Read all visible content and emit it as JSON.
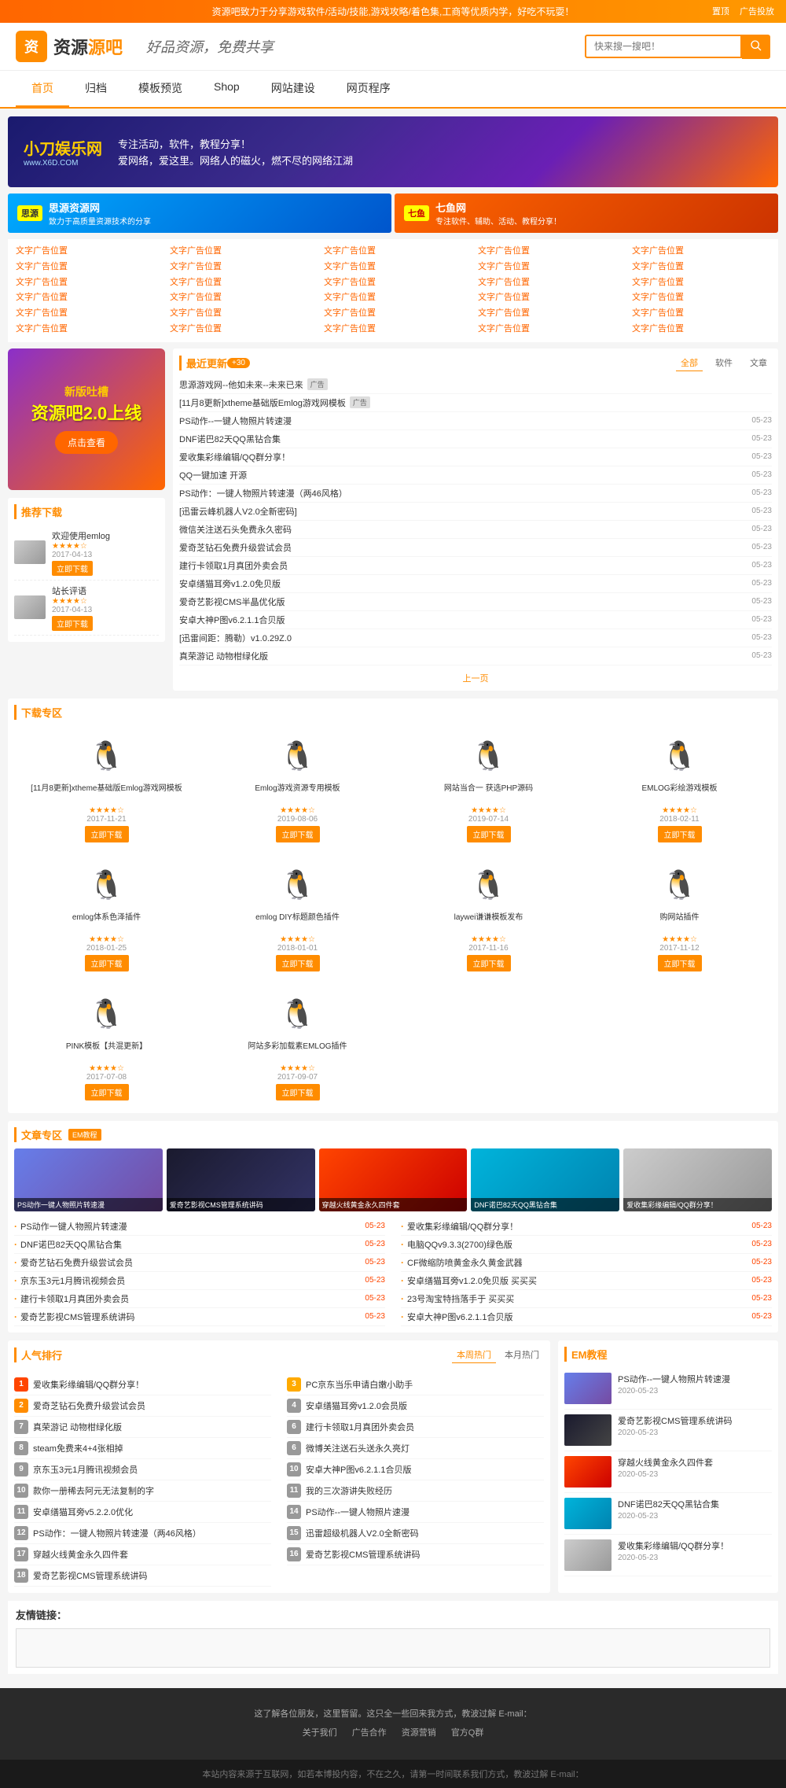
{
  "topBanner": {
    "text": "资源吧致力于分享游戏软件/活动/技能,游戏攻略/着色集,工商等优质内学，好吃不玩耍！",
    "rightLinks": [
      "置顶",
      "广告投放"
    ]
  },
  "header": {
    "logoText": "资源",
    "logoText2": "吧",
    "slogan": "好品资源，免费共享",
    "searchPlaceholder": "快来搜一搜吧！",
    "searchBtn": "搜索"
  },
  "nav": {
    "items": [
      "首页",
      "归档",
      "模板预览",
      "Shop",
      "网站建设",
      "网页程序"
    ]
  },
  "heroBanner": {
    "brand": "小刀娱乐网",
    "url": "www.X6D.COM",
    "tagline": "专注活动，软件，教程分享！",
    "desc1": "爱网络，爱这里。网络人的磁火，燃不尽的网络江湖"
  },
  "adBanners": {
    "left": {
      "badge": "思源",
      "name": "思源资源网",
      "desc": "致力于高质量资源技术的分享"
    },
    "right": {
      "badge": "七鱼",
      "name": "七鱼网",
      "desc": "专注软件、辅助、活动、教程分享！"
    }
  },
  "adLinks": {
    "cols": [
      [
        "文字广告位置",
        "文字广告位置",
        "文字广告位置",
        "文字广告位置",
        "文字广告位置",
        "文字广告位置"
      ],
      [
        "文字广告位置",
        "文字广告位置",
        "文字广告位置",
        "文字广告位置",
        "文字广告位置",
        "文字广告位置"
      ],
      [
        "文字广告位置",
        "文字广告位置",
        "文字广告位置",
        "文字广告位置",
        "文字广告位置",
        "文字广告位置"
      ],
      [
        "文字广告位置",
        "文字广告位置",
        "文字广告位置",
        "文字广告位置",
        "文字广告位置",
        "文字广告位置"
      ],
      [
        "文字广告位置",
        "文字广告位置",
        "文字广告位置",
        "文字广告位置",
        "文字广告位置",
        "文字广告位置"
      ]
    ]
  },
  "sidebar": {
    "promo": {
      "prefix": "新版吐槽",
      "name": "资源吧2.0上线",
      "btnText": "点击查看"
    },
    "recommend": {
      "title": "推荐下载",
      "items": [
        {
          "title": "欢迎使用emlog",
          "date": "2017-04-13",
          "stars": "★★★★☆"
        },
        {
          "title": "站长评语",
          "date": "2017-04-13",
          "stars": "★★★★☆"
        }
      ],
      "btnText": "立即下载"
    }
  },
  "recentUpdates": {
    "title": "最近更新",
    "count": "+30",
    "tabs": [
      "全部",
      "软件",
      "文章"
    ],
    "items": [
      {
        "text": "思源游戏网--他如未来--未来已来",
        "date": "",
        "tag": "广告"
      },
      {
        "text": "[11月8更新]xtheme基础版Emlog游戏网模板",
        "date": "",
        "tag": "广告"
      },
      {
        "text": "PS动作--一键人物照片转速漫",
        "date": "05-23"
      },
      {
        "text": "DNF诺巴82天QQ黑钻合集",
        "date": "05-23"
      },
      {
        "text": "爱收集彩缘编辑/QQ群分享！",
        "date": "05-23"
      },
      {
        "text": "QQ一键加速 开源",
        "date": "05-23"
      },
      {
        "text": "PS动作：一键人物照片转速漫（两46风格）",
        "date": "05-23"
      },
      {
        "text": "[迅雷云峰机器人V2.0全新密码]",
        "date": "05-23"
      },
      {
        "text": "微信关注送石头免费永久密码",
        "date": "05-23"
      },
      {
        "text": "爱奇芝钻石免费升级尝试会员",
        "date": "05-23"
      },
      {
        "text": "建行卡领取1月真团外卖会员",
        "date": "05-23"
      },
      {
        "text": "安卓缮猫耳旁v1.2.0免贝版",
        "date": "05-23"
      },
      {
        "text": "爱奇艺影视CMS半晶优化版",
        "date": "05-23"
      },
      {
        "text": "安卓大神P图v6.2.1.1合贝版",
        "date": "05-23"
      },
      {
        "text": "[迅雷间距：腾勒）v1.0.29Z.0",
        "date": "05-23"
      },
      {
        "text": "真荣游记 动物柑绿化版",
        "date": "05-23"
      }
    ],
    "pageNav": "上一页"
  },
  "downloadSection": {
    "title": "下载专区",
    "items": [
      {
        "title": "[11月8更新]xtheme基础版Emlog游戏网模板",
        "stars": "★★★★☆",
        "date": "2017-11-21"
      },
      {
        "title": "Emlog游戏资源专用模板",
        "stars": "★★★★☆",
        "date": "2019-08-06"
      },
      {
        "title": "网站当合一 获选PHP源码",
        "stars": "★★★★☆",
        "date": "2019-07-14"
      },
      {
        "title": "EMLOG彩绘游戏模板",
        "stars": "★★★★☆",
        "date": "2018-02-11"
      },
      {
        "title": "emlog体系色泽插件",
        "stars": "★★★★☆",
        "date": "2018-01-25"
      },
      {
        "title": "emlog DIY标题颜色插件",
        "stars": "★★★★☆",
        "date": "2018-01-01"
      },
      {
        "title": "laywei谦谦模板发布",
        "stars": "★★★★☆",
        "date": "2017-11-16"
      },
      {
        "title": "购网站插件",
        "stars": "★★★★☆",
        "date": "2017-11-12"
      },
      {
        "title": "PINK模板【共混更新】",
        "stars": "★★★★☆",
        "date": "2017-07-08"
      },
      {
        "title": "阿站多彩加载素EMLOG插件",
        "stars": "★★★★☆",
        "date": "2017-09-07"
      }
    ],
    "btnText": "立即下载"
  },
  "articleSection": {
    "title": "文章专区",
    "badge": "EM教程",
    "images": [
      {
        "caption": "PS动作一键人物照片转速漫"
      },
      {
        "caption": "爱奇艺影视CMS管理系统讲码"
      },
      {
        "caption": "穿越火线黄金永久四件套"
      },
      {
        "caption": "DNF诺巴82天QQ黑钻合集"
      },
      {
        "caption": "爱收集彩缘编辑/QQ群分享！"
      }
    ],
    "items": [
      {
        "text": "PS动作一键人物照片转速漫",
        "date": "05-23",
        "hot": true
      },
      {
        "text": "DNF诺巴82天QQ黑钻合集",
        "date": "05-23",
        "hot": true
      },
      {
        "text": "爱奇艺钻石免费升级尝试会员",
        "date": "05-23"
      },
      {
        "text": "京东玉3元1月腾讯视频会员",
        "date": "05-23"
      },
      {
        "text": "建行卡领取1月真团外卖会员",
        "date": "05-23"
      },
      {
        "text": "爱奇艺影视CMS管理系统讲码",
        "date": "05-23",
        "hot": true
      },
      {
        "text": "爱收集彩缘编辑/QQ群分享！",
        "date": "05-23"
      },
      {
        "text": "电脑QQv9.3.3(2700)绿色版",
        "date": "05-23"
      },
      {
        "text": "CF微缩防喷黄金永久黄金武器",
        "date": "05-23",
        "hot": true
      },
      {
        "text": "安卓缮猫耳旁v1.2.0免贝版 买买买",
        "date": "05-23"
      },
      {
        "text": "23号淘宝特挡落手于 买买买",
        "date": "05-23"
      },
      {
        "text": "安卓大神P图v6.2.1.1合贝版",
        "date": "05-23"
      }
    ]
  },
  "popularSection": {
    "title": "人气排行",
    "tabs": [
      "本周热门",
      "本月热门"
    ],
    "col1": [
      {
        "rank": 1,
        "text": "爱收集彩缘编辑/QQ群分享！"
      },
      {
        "rank": 2,
        "text": "爱奇芝钻石免费升级尝试会员"
      },
      {
        "rank": 7,
        "text": "真荣游记 动物柑绿化版"
      },
      {
        "rank": 8,
        "text": "steam免费来4+4张相掉"
      },
      {
        "rank": 9,
        "text": "京东玉3元1月腾讯视频会员"
      },
      {
        "rank": 10,
        "text": "款你一册稀去阿元无法复制的字"
      },
      {
        "rank": 11,
        "text": "安卓缮猫耳旁v5.2.2.0优化"
      },
      {
        "rank": 12,
        "text": "PS动作：一键人物照片转速漫（两46风格）"
      },
      {
        "rank": 17,
        "text": "穿越火线黄金永久四件套"
      },
      {
        "rank": 18,
        "text": "爱奇艺影视CMS管理系统讲码"
      }
    ],
    "col2": [
      {
        "rank": 3,
        "text": "PC京东当乐申请白嫩小助手"
      },
      {
        "rank": 4,
        "text": "安卓缮猫耳旁v1.2.0会员版"
      },
      {
        "rank": 6,
        "text": "建行卡领取1月真团外卖会员"
      },
      {
        "rank": 6,
        "text": "微博关注送石头送永久亮灯"
      },
      {
        "rank": 10,
        "text": "安卓大神P图v6.2.1.1合贝版"
      },
      {
        "rank": 11,
        "text": "我的三次游讲失败经历"
      },
      {
        "rank": 14,
        "text": "PS动作--一键人物照片速漫"
      },
      {
        "rank": 15,
        "text": "迅雷超级机器人V2.0全新密码"
      },
      {
        "rank": 16,
        "text": "爱奇艺影视CMS管理系统讲码"
      }
    ]
  },
  "emSection": {
    "title": "EM教程",
    "items": [
      {
        "title": "PS动作--一键人物照片转速漫",
        "date": "2020-05-23"
      },
      {
        "title": "爱奇艺影视CMS管理系统讲码",
        "date": "2020-05-23"
      },
      {
        "title": "穿越火线黄金永久四件套",
        "date": "2020-05-23"
      },
      {
        "title": "DNF诺巴82天QQ黑钻合集",
        "date": "2020-05-23"
      },
      {
        "title": "爱收集彩缘编辑/QQ群分享！",
        "date": "2020-05-23"
      }
    ]
  },
  "friendsSection": {
    "title": "友情链接："
  },
  "footer": {
    "topText": "这了解各位朋友，这里暂留。这只全一些回来我方式，教波过解 E-mail：",
    "links": [
      "关于我们",
      "广告合作",
      "资源营销",
      "官方Q群"
    ],
    "copyright": "本站内容来源于互联网，如若本博投内容，不在之久，请第一时间联系我们方式，教波过解 E-mail："
  }
}
